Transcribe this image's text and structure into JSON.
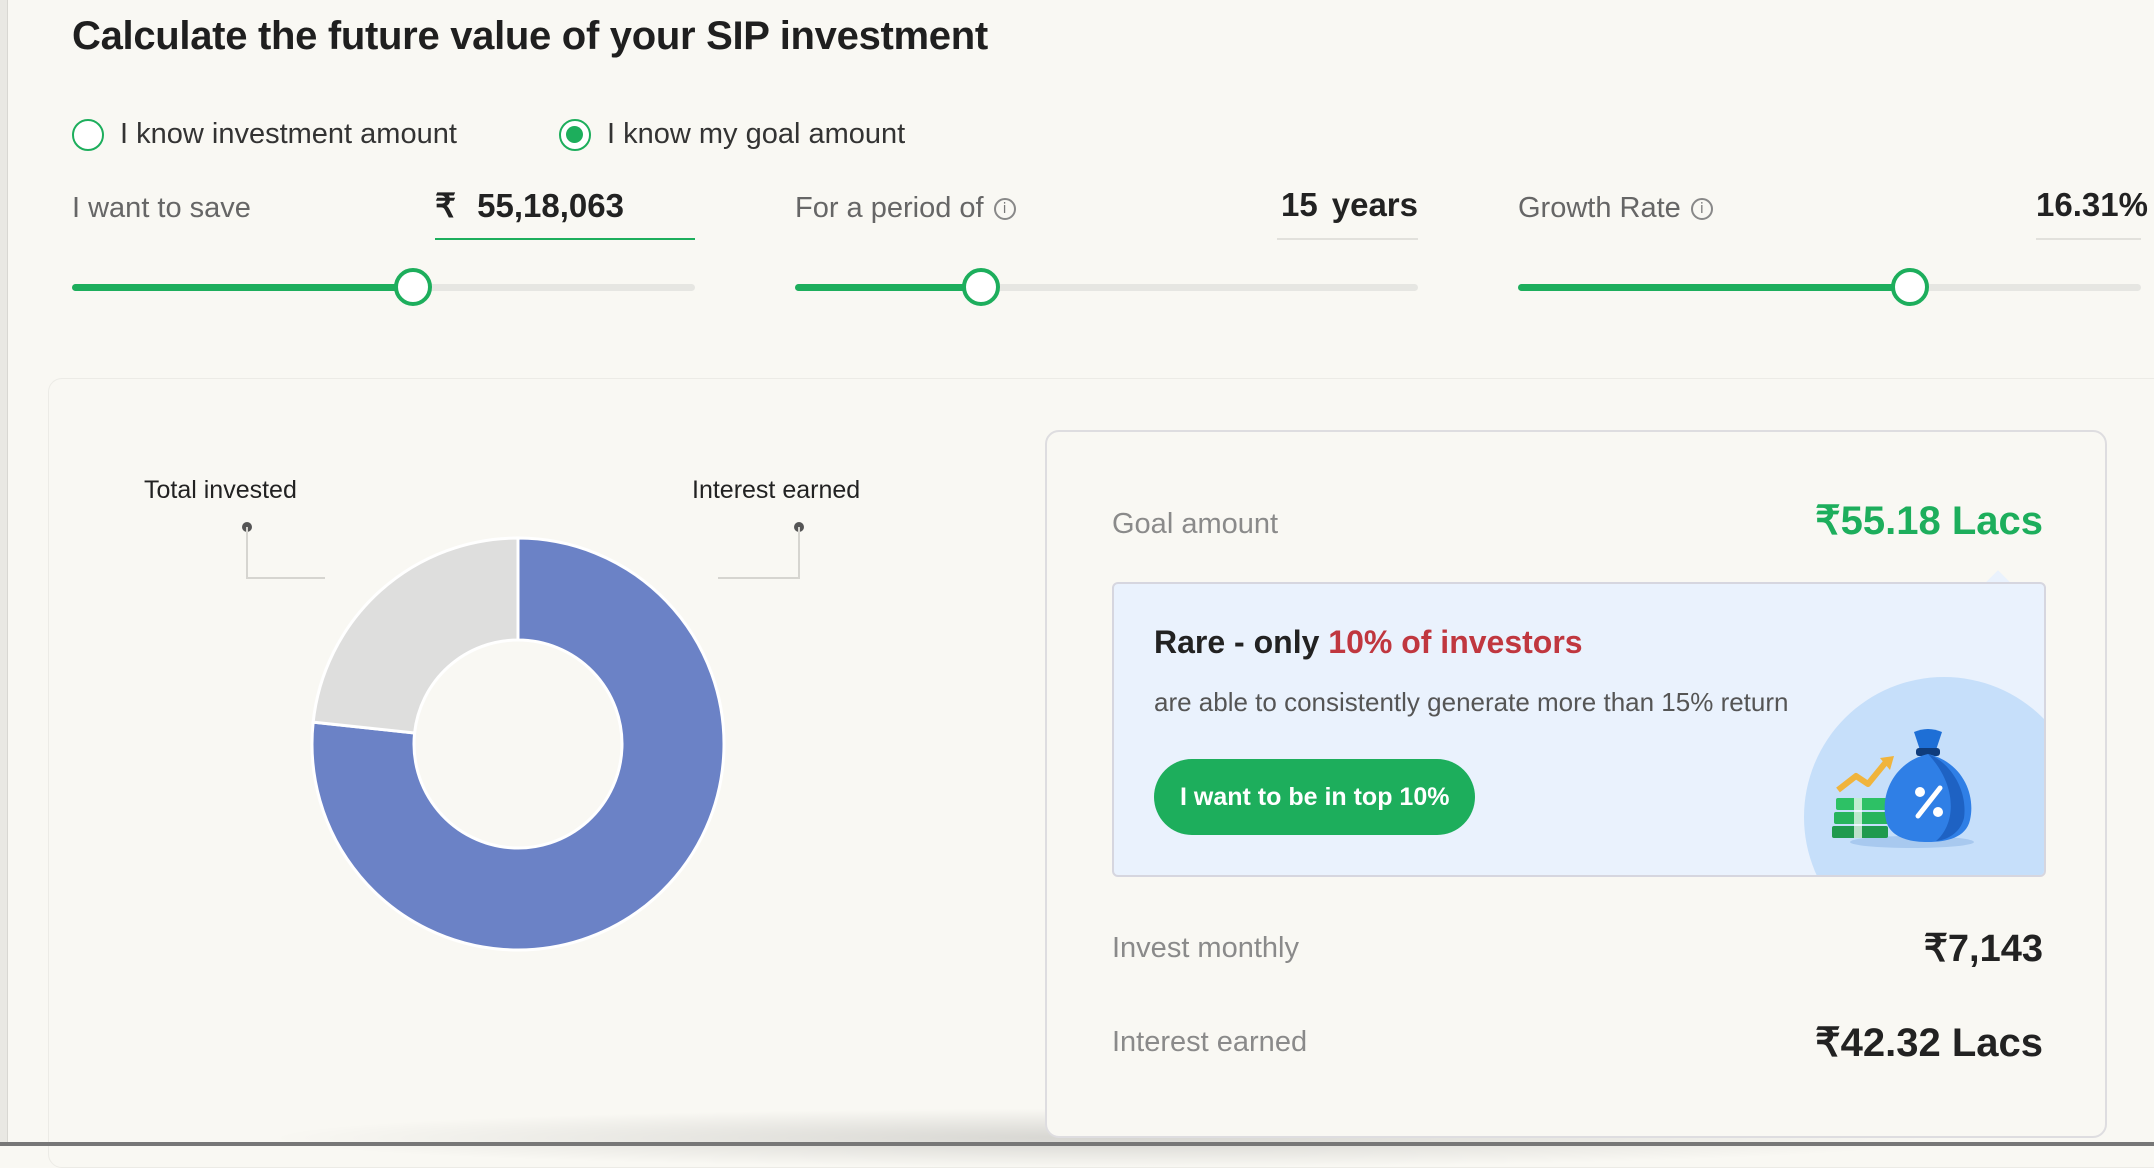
{
  "page": {
    "title": "Calculate the future value of your SIP investment"
  },
  "mode": {
    "options": [
      {
        "label": "I know investment amount",
        "selected": false
      },
      {
        "label": "I know my goal amount",
        "selected": true
      }
    ]
  },
  "controls": {
    "save": {
      "label": "I want to save",
      "currency": "₹",
      "value": "55,18,063",
      "slider_fraction": 0.548
    },
    "period": {
      "label": "For a period of",
      "value": "15",
      "unit": "years",
      "slider_fraction": 0.298
    },
    "growth": {
      "label": "Growth Rate",
      "value": "16.31%",
      "slider_fraction": 0.629
    }
  },
  "chart_data": {
    "type": "pie",
    "variant": "donut",
    "labels": [
      "Total invested",
      "Interest earned"
    ],
    "values": [
      12.86,
      42.32
    ],
    "unit": "Lacs",
    "colors": [
      "#dededd",
      "#6b82c6"
    ]
  },
  "results": {
    "goal": {
      "label": "Goal amount",
      "value": "₹55.18 Lacs"
    },
    "promo": {
      "title_prefix": "Rare - only",
      "title_accent": "10% of investors",
      "text": "are able to consistently generate more than 15% return",
      "button": "I want to be in top 10%",
      "illustration": "money-bag-percent-icon"
    },
    "monthly": {
      "label": "Invest monthly",
      "value": "₹7,143"
    },
    "interest": {
      "label": "Interest earned",
      "value": "₹42.32 Lacs"
    }
  },
  "colors": {
    "accent": "#1dae5c",
    "donut_interest": "#6b82c6",
    "donut_invested": "#dededd",
    "promo_accent": "#c0373f",
    "promo_bg": "#eaf2fd"
  }
}
